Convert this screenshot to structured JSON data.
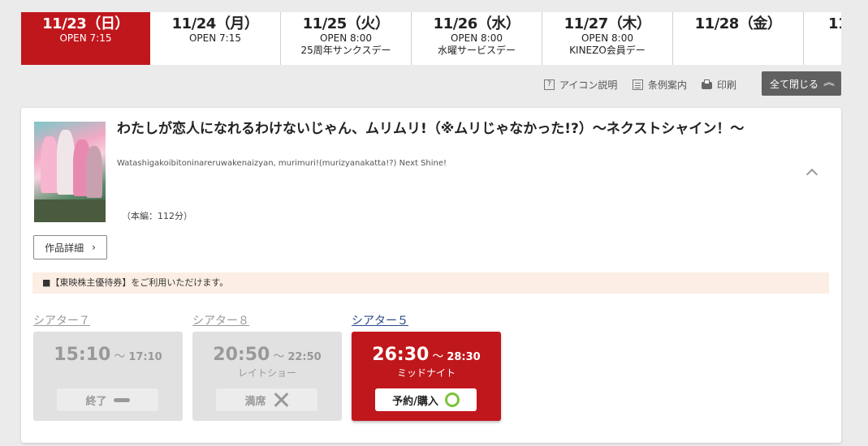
{
  "dates": [
    {
      "date": "11/23（日）",
      "lines": [
        "OPEN 7:15"
      ],
      "active": true
    },
    {
      "date": "11/24（月）",
      "lines": [
        "OPEN 7:15"
      ]
    },
    {
      "date": "11/25（火）",
      "lines": [
        "OPEN 8:00",
        "25周年サンクスデー"
      ]
    },
    {
      "date": "11/26（水）",
      "lines": [
        "OPEN 8:00",
        "水曜サービスデー"
      ]
    },
    {
      "date": "11/27（木）",
      "lines": [
        "OPEN 8:00",
        "KINEZO会員デー"
      ]
    },
    {
      "date": "11/28（金）",
      "lines": []
    },
    {
      "date": "11",
      "lines": []
    }
  ],
  "toolbar": {
    "icon_help": "アイコン説明",
    "terms": "条例案内",
    "print": "印刷",
    "close_all": "全て閉じる",
    "help_glyph": "?"
  },
  "movie": {
    "title": "わたしが恋人になれるわけないじゃん、ムリムリ!（※ムリじゃなかった!?）～ネクストシャイン！～",
    "title_roman": "Watashigakoibitoninareruwakenaizyan, murimuri!(murizyanakatta!?) Next Shine!",
    "runtime": "（本編：112分）",
    "detail_button": "作品詳細",
    "detail_chevron": "›",
    "notice": "■【東映株主優待券】をご利用いただけます。"
  },
  "showtimes": [
    {
      "theater": "シアター７",
      "start": "15:10",
      "end": "17:10",
      "note": "",
      "status": "終了",
      "state": "ended"
    },
    {
      "theater": "シアター８",
      "start": "20:50",
      "end": "22:50",
      "note": "レイトショー",
      "status": "満席",
      "state": "full"
    },
    {
      "theater": "シアター５",
      "start": "26:30",
      "end": "28:30",
      "note": "ミッドナイト",
      "status": "予約/購入",
      "state": "available"
    }
  ],
  "colors": {
    "accent": "#c0171c",
    "available": "#7cc33a",
    "link": "#2c4a8a"
  }
}
